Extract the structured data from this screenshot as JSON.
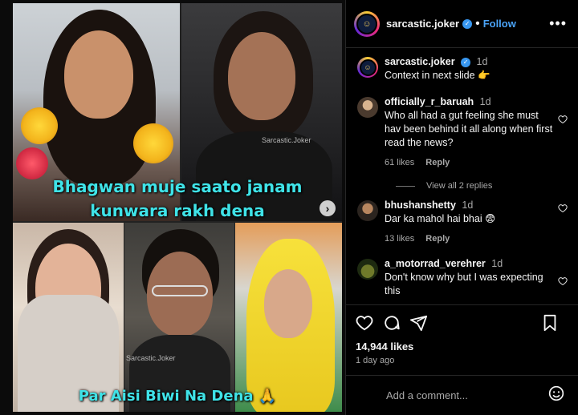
{
  "post": {
    "caption_top": "Bhagwan muje saato janam kunwara rakh dena",
    "caption_bottom": "Par Aisi Biwi Na Dena 🙏",
    "watermark": "Sarcastic.Joker",
    "next_icon": "chevron-right-icon"
  },
  "header": {
    "username": "sarcastic.joker",
    "separator": "•",
    "follow_label": "Follow",
    "more_icon": "more-horizontal-icon",
    "more_label": "•••"
  },
  "comments": [
    {
      "user": "sarcastic.joker",
      "time": "1d",
      "text": "Context in next slide 👉",
      "likes": "",
      "reply": ""
    },
    {
      "user": "officially_r_baruah",
      "time": "1d",
      "text": "Who all had a gut feeling she must hav been behind it all along when first read the news?",
      "likes": "61 likes",
      "reply": "Reply"
    },
    {
      "user": "bhushanshetty",
      "time": "1d",
      "text": "Dar ka mahol hai bhai 😨",
      "likes": "13 likes",
      "reply": "Reply"
    },
    {
      "user": "a_motorrad_verehrer",
      "time": "1d",
      "text": "Don't know why but I was expecting this",
      "likes": "",
      "reply": ""
    }
  ],
  "view_replies": "View all 2 replies",
  "actions": {
    "likes": "14,944 likes",
    "date": "1 day ago"
  },
  "add_comment": {
    "placeholder": "Add a comment..."
  },
  "colors": {
    "caption": "#3fe3e8",
    "follow": "#4aa3f7",
    "verified": "#3897f0",
    "background": "#000000"
  }
}
